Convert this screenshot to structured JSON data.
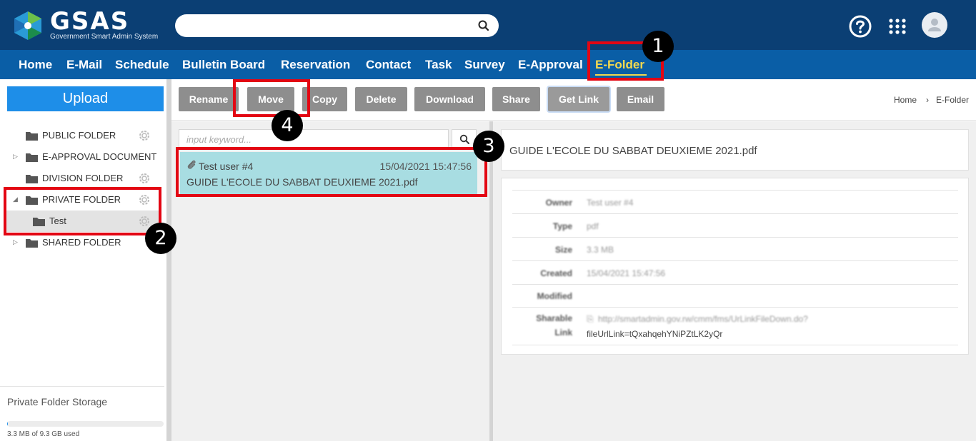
{
  "app": {
    "logo_text": "GSAS",
    "logo_subtitle": "Government Smart Admin System",
    "search_icon": "search-icon",
    "help_icon": "help-circle-icon",
    "apps_icon": "grid-apps-icon",
    "avatar_icon": "user-avatar-icon",
    "colors": {
      "topbar": "#0b3f74",
      "nav": "#0a5ea6",
      "active_nav": "#f4d94e",
      "accent": "#1e8ee8",
      "highlight": "#a8dde2",
      "annotation": "#e30613"
    }
  },
  "nav": {
    "items": [
      {
        "label": "Home"
      },
      {
        "label": "E-Mail"
      },
      {
        "label": "Schedule"
      },
      {
        "label": "Bulletin Board"
      },
      {
        "label": "Reservation"
      },
      {
        "label": "Contact"
      },
      {
        "label": "Task"
      },
      {
        "label": "Survey"
      },
      {
        "label": "E-Approval"
      },
      {
        "label": "E-Folder",
        "active": true
      }
    ]
  },
  "sidebar": {
    "upload_label": "Upload",
    "tree": [
      {
        "label": "PUBLIC FOLDER",
        "arrow": "",
        "has_gear": true
      },
      {
        "label": "E-APPROVAL DOCUMENT",
        "arrow": "▷",
        "has_gear": false
      },
      {
        "label": "DIVISION FOLDER",
        "arrow": "",
        "has_gear": true
      },
      {
        "label": "PRIVATE FOLDER",
        "arrow": "◢",
        "has_gear": true
      },
      {
        "label": "Test",
        "arrow": "",
        "has_gear": true,
        "selected": true,
        "child": true
      },
      {
        "label": "SHARED FOLDER",
        "arrow": "▷",
        "has_gear": false
      }
    ],
    "storage": {
      "title": "Private Folder Storage",
      "used_text": "3.3 MB of 9.3 GB used",
      "used_fraction": 0.0004
    }
  },
  "toolbar": {
    "buttons": [
      {
        "label": "Rename"
      },
      {
        "label": "Move"
      },
      {
        "label": "Copy"
      },
      {
        "label": "Delete"
      },
      {
        "label": "Download"
      },
      {
        "label": "Share"
      },
      {
        "label": "Get Link"
      },
      {
        "label": "Email"
      }
    ],
    "breadcrumb": {
      "home": "Home",
      "separator": "›",
      "current": "E-Folder"
    }
  },
  "file_list": {
    "search_placeholder": "input keyword...",
    "files": [
      {
        "owner": "Test user #4",
        "date": "15/04/2021 15:47:56",
        "name": "GUIDE L'ECOLE DU SABBAT DEUXIEME 2021.pdf"
      }
    ]
  },
  "detail": {
    "title": "GUIDE L'ECOLE DU SABBAT DEUXIEME 2021.pdf",
    "rows": [
      {
        "label": "Owner",
        "value": "Test user #4"
      },
      {
        "label": "Type",
        "value": "pdf"
      },
      {
        "label": "Size",
        "value": "3.3 MB"
      },
      {
        "label": "Created",
        "value": "15/04/2021 15:47:56"
      },
      {
        "label": "Modified",
        "value": ""
      },
      {
        "label": "Sharable",
        "label2": "Link",
        "value": "http://smartadmin.gov.rw/cmm/fms/UrLinkFileDown.do?",
        "value2": "fileUrlLink=tQxahqehYNiPZtLK2yQr"
      }
    ]
  },
  "annotations": {
    "badges": [
      "1",
      "2",
      "3",
      "4"
    ]
  }
}
